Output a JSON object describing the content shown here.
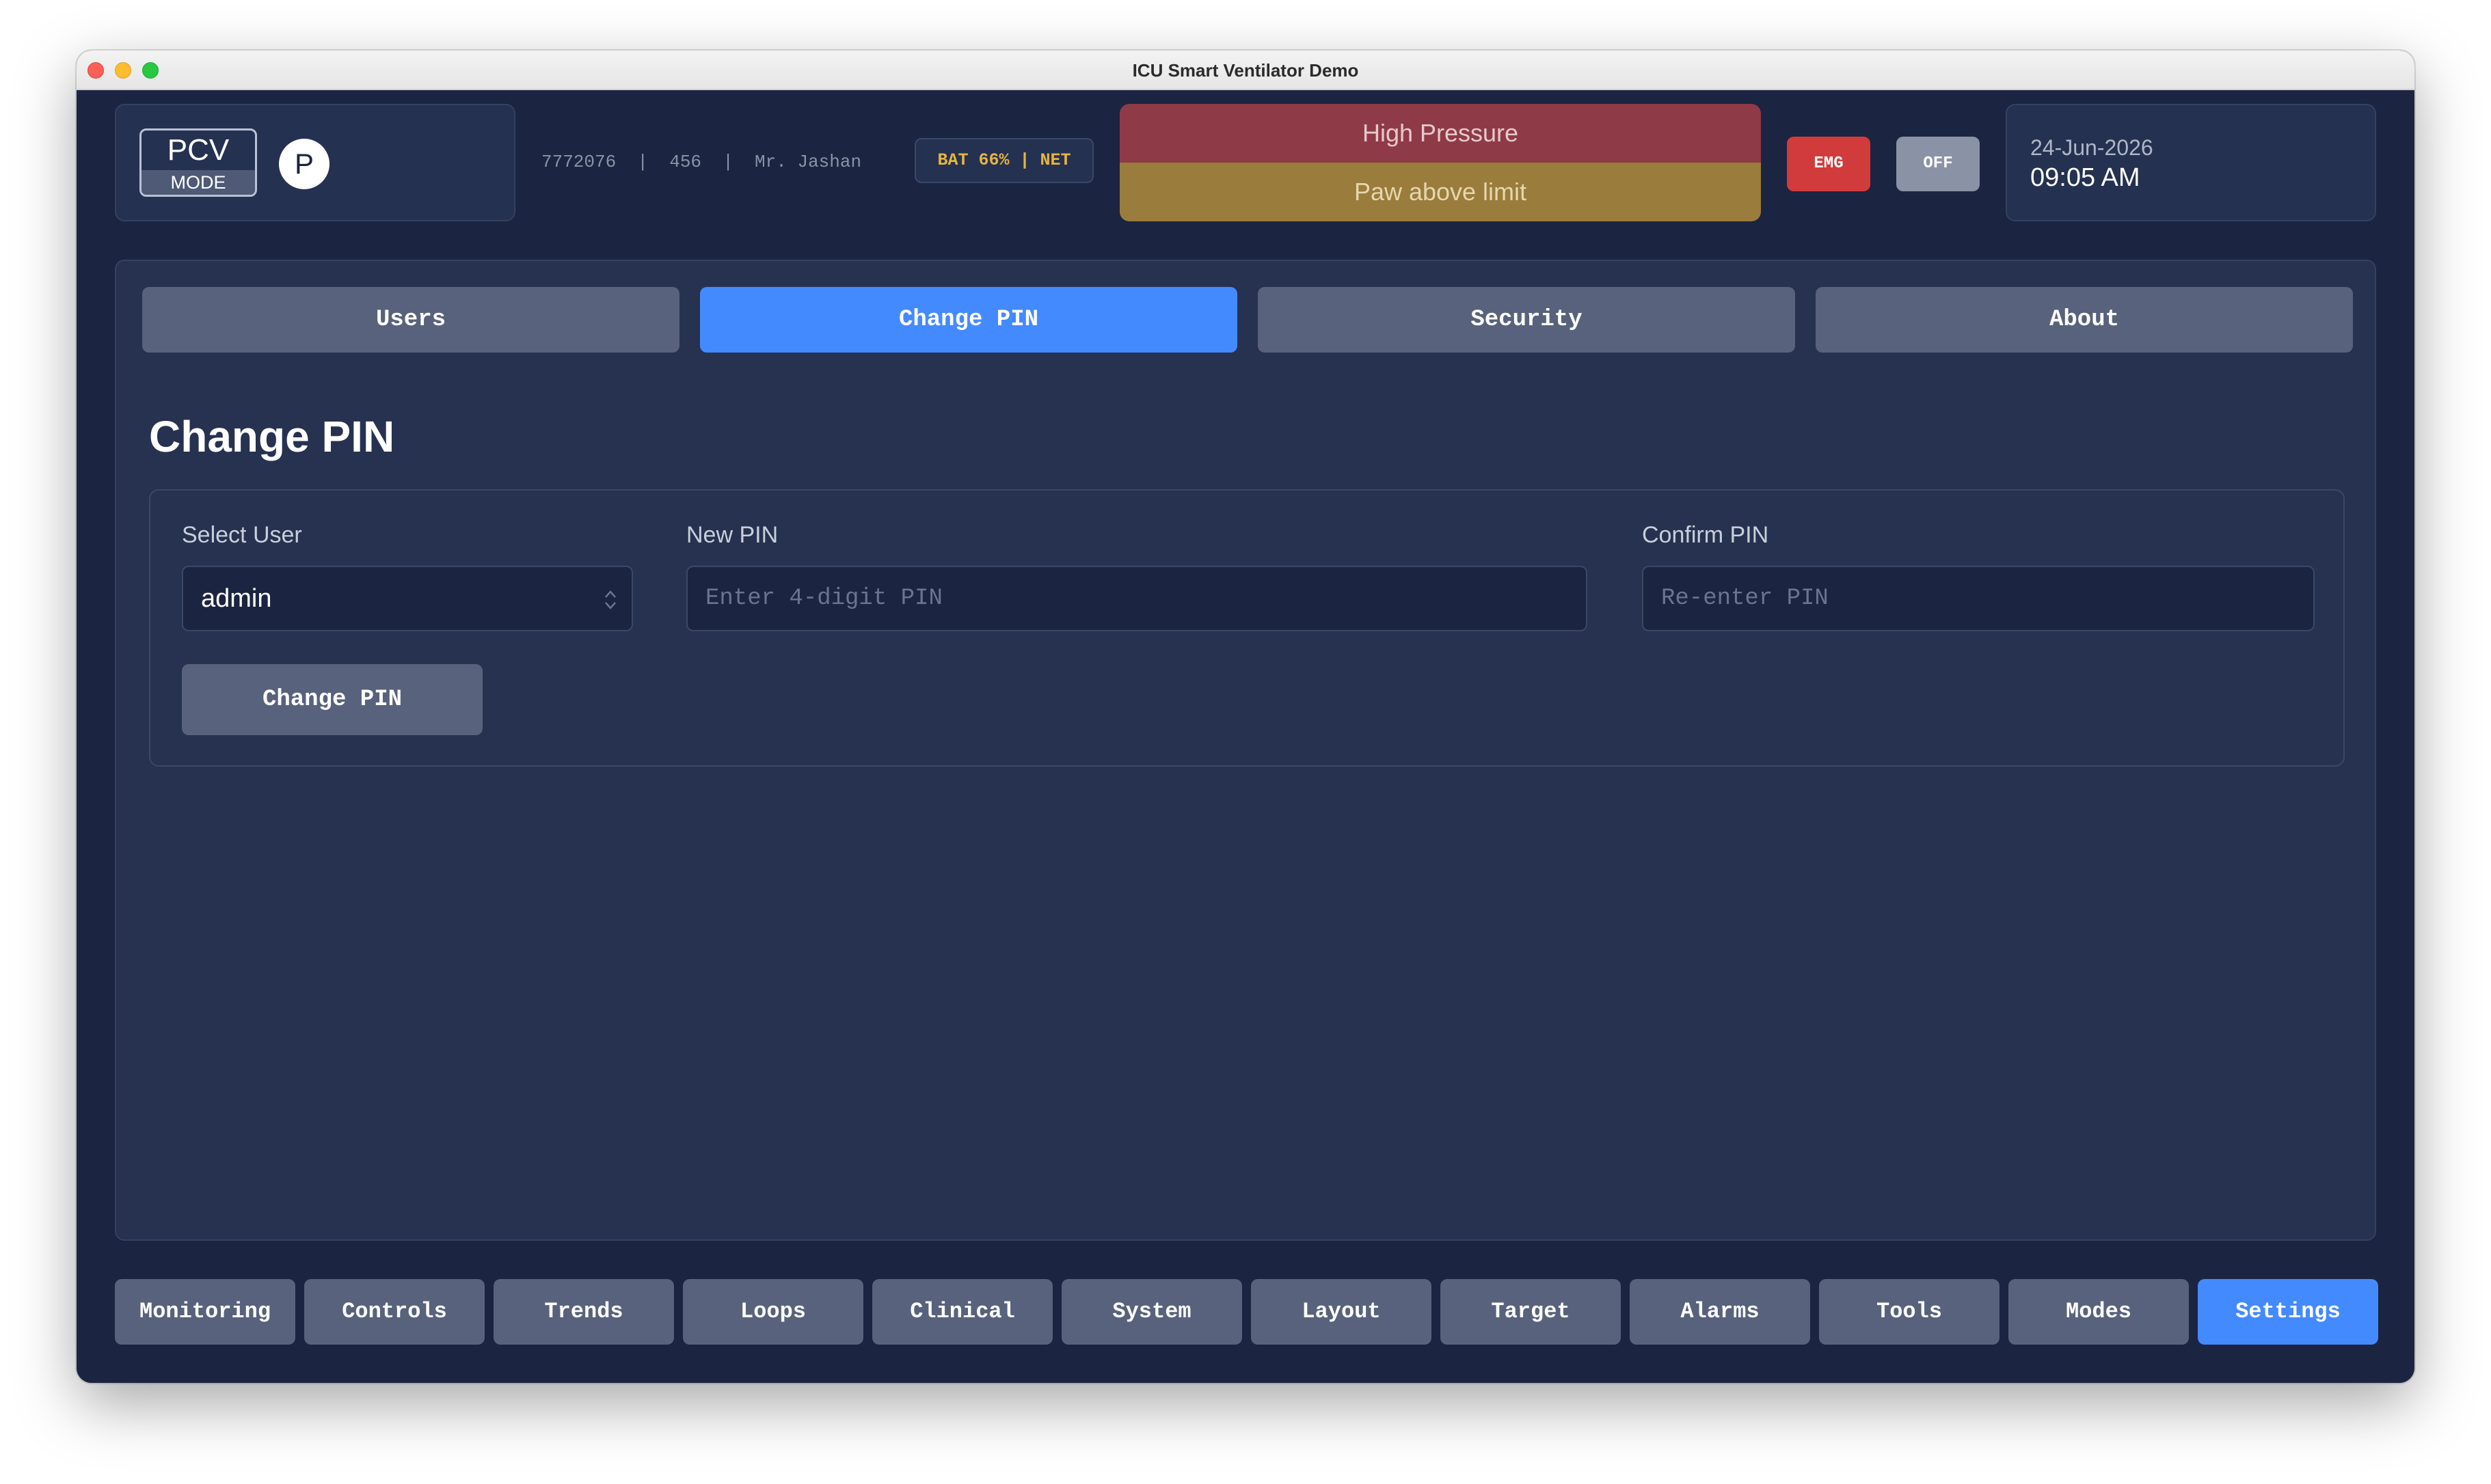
{
  "window": {
    "title": "ICU Smart Ventilator Demo"
  },
  "header": {
    "mode": {
      "name": "PCV",
      "label": "MODE",
      "badge": "P"
    },
    "patient_info": "7772076  |  456  |  Mr. Jashan",
    "status": "BAT 66% | NET",
    "alarm": {
      "title": "High Pressure",
      "detail": "Paw above limit",
      "title_color": "#8e3a47",
      "detail_color": "#9a7c3c"
    },
    "emg_label": "EMG",
    "off_label": "OFF",
    "date": "24-Jun-2026",
    "time": "09:05 AM"
  },
  "settings": {
    "tabs": [
      {
        "label": "Users",
        "active": false
      },
      {
        "label": "Change PIN",
        "active": true
      },
      {
        "label": "Security",
        "active": false
      },
      {
        "label": "About",
        "active": false
      }
    ],
    "section_title": "Change PIN",
    "form": {
      "select_user_label": "Select User",
      "select_user_value": "admin",
      "new_pin_label": "New PIN",
      "new_pin_placeholder": "Enter 4-digit PIN",
      "confirm_pin_label": "Confirm PIN",
      "confirm_pin_placeholder": "Re-enter PIN",
      "submit_label": "Change PIN"
    }
  },
  "nav": {
    "items": [
      {
        "label": "Monitoring",
        "active": false
      },
      {
        "label": "Controls",
        "active": false
      },
      {
        "label": "Trends",
        "active": false
      },
      {
        "label": "Loops",
        "active": false
      },
      {
        "label": "Clinical",
        "active": false
      },
      {
        "label": "System",
        "active": false
      },
      {
        "label": "Layout",
        "active": false
      },
      {
        "label": "Target",
        "active": false
      },
      {
        "label": "Alarms",
        "active": false
      },
      {
        "label": "Tools",
        "active": false
      },
      {
        "label": "Modes",
        "active": false
      },
      {
        "label": "Settings",
        "active": true
      }
    ]
  },
  "colors": {
    "accent": "#448aff",
    "background": "#1b2440",
    "panel": "#263250",
    "button": "#58627c",
    "emergency": "#d23b3b"
  }
}
